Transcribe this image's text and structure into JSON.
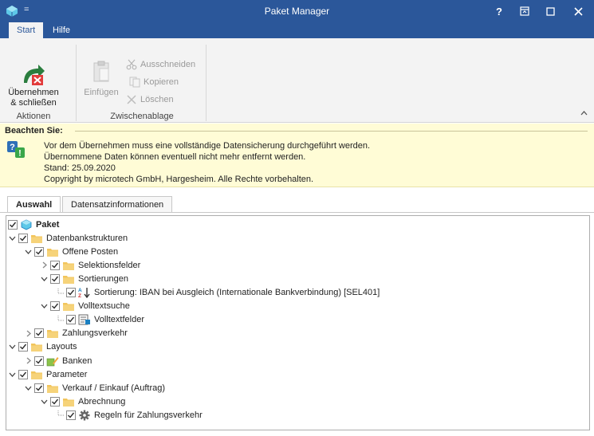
{
  "window": {
    "title": "Paket Manager",
    "qat_glyph": "=",
    "buttons": {
      "help": "?",
      "restore": "⊡",
      "maximize": "□",
      "close": "✕"
    }
  },
  "ribbon": {
    "tabs": [
      {
        "label": "Start",
        "active": true
      },
      {
        "label": "Hilfe",
        "active": false
      }
    ],
    "aktionen": {
      "apply_label_line1": "Übernehmen",
      "apply_label_line2": "& schließen",
      "group_label": "Aktionen"
    },
    "zwischenablage": {
      "paste_label": "Einfügen",
      "cut_label": "Ausschneiden",
      "copy_label": "Kopieren",
      "delete_label": "Löschen",
      "group_label": "Zwischenablage"
    },
    "collapse_glyph": "^"
  },
  "info": {
    "heading": "Beachten Sie:",
    "lines": [
      "Vor dem Übernehmen muss eine vollständige Datensicherung durchgeführt werden.",
      "Übernommene Daten können eventuell nicht mehr entfernt werden.",
      "Stand: 25.09.2020",
      "Copyright by microtech GmbH, Hargesheim. Alle Rechte vorbehalten."
    ]
  },
  "content_tabs": [
    {
      "label": "Auswahl",
      "active": true
    },
    {
      "label": "Datensatzinformationen",
      "active": false
    }
  ],
  "tree": [
    {
      "label": "Paket",
      "level": 0,
      "expander": "none",
      "icon": "package-icon",
      "bold": true,
      "checked": true
    },
    {
      "label": "Datenbankstrukturen",
      "level": 0,
      "expander": "expanded",
      "icon": "folder-icon",
      "checked": true
    },
    {
      "label": "Offene Posten",
      "level": 1,
      "expander": "expanded",
      "icon": "folder-icon",
      "checked": true
    },
    {
      "label": "Selektionsfelder",
      "level": 2,
      "expander": "collapsed",
      "icon": "folder-icon",
      "checked": true
    },
    {
      "label": "Sortierungen",
      "level": 2,
      "expander": "expanded",
      "icon": "folder-icon",
      "checked": true
    },
    {
      "label": "Sortierung: IBAN bei Ausgleich (Internationale Bankverbindung) [SEL401]",
      "level": 3,
      "expander": "none",
      "icon": "sort-az-icon",
      "checked": true
    },
    {
      "label": "Volltextsuche",
      "level": 2,
      "expander": "expanded",
      "icon": "folder-icon",
      "checked": true
    },
    {
      "label": "Volltextfelder",
      "level": 3,
      "expander": "none",
      "icon": "fulltext-fields-icon",
      "checked": true
    },
    {
      "label": "Zahlungsverkehr",
      "level": 1,
      "expander": "collapsed",
      "icon": "folder-icon",
      "checked": true
    },
    {
      "label": "Layouts",
      "level": 0,
      "expander": "expanded",
      "icon": "folder-icon",
      "checked": true
    },
    {
      "label": "Banken",
      "level": 1,
      "expander": "collapsed",
      "icon": "bank-layout-icon",
      "checked": true
    },
    {
      "label": "Parameter",
      "level": 0,
      "expander": "expanded",
      "icon": "folder-icon",
      "checked": true
    },
    {
      "label": "Verkauf / Einkauf (Auftrag)",
      "level": 1,
      "expander": "expanded",
      "icon": "folder-icon",
      "checked": true
    },
    {
      "label": "Abrechnung",
      "level": 2,
      "expander": "expanded",
      "icon": "folder-icon",
      "checked": true
    },
    {
      "label": "Regeln für Zahlungsverkehr",
      "level": 3,
      "expander": "none",
      "icon": "gear-icon",
      "checked": true
    }
  ],
  "colors": {
    "titlebar": "#2b579a",
    "ribbon": "#f3f3f3",
    "info_bg": "#fffcd6",
    "folder": "#f2c55c",
    "accent_blue": "#1a7fc1"
  }
}
